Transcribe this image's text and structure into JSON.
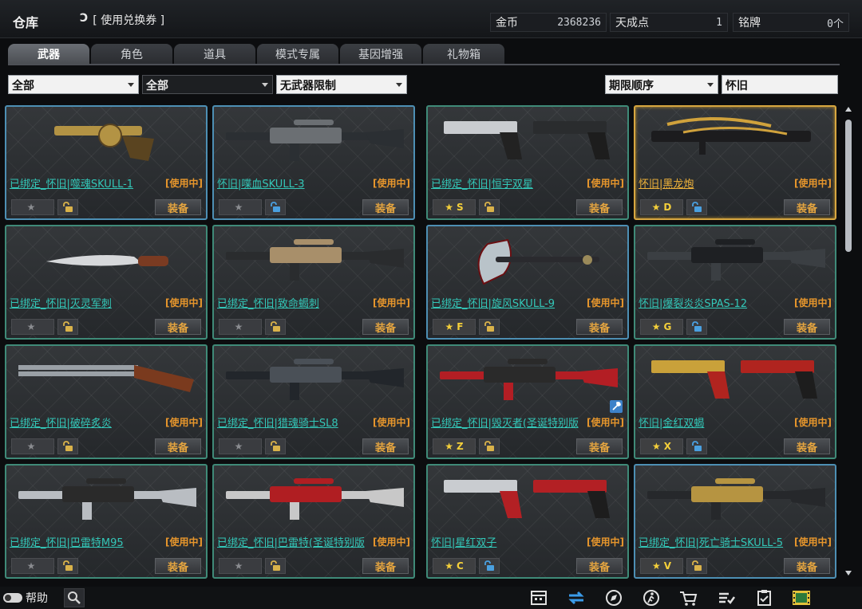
{
  "header": {
    "title": "仓库",
    "coupon_arrow": "Ↄ",
    "coupon_label": "[ 使用兑换券 ]",
    "stats": [
      {
        "label": "金币",
        "value": "2368236"
      },
      {
        "label": "天成点",
        "value": "1"
      },
      {
        "label": "铭牌",
        "value": "0个"
      }
    ]
  },
  "tabs": [
    "武器",
    "角色",
    "道具",
    "模式专属",
    "基因增强",
    "礼物箱"
  ],
  "filters": {
    "filter1": "全部",
    "filter2": "全部",
    "filter3": "无武器限制",
    "sort": "期限顺序",
    "search_value": "怀旧"
  },
  "items": [
    {
      "name": "已绑定_怀旧|噬魂SKULL-1",
      "status": "[使用中]",
      "grade_star": "★",
      "grade": "",
      "lock": "gold",
      "equip": "装备",
      "border": "blue",
      "art": "revolver"
    },
    {
      "name": "怀旧|喋血SKULL-3",
      "status": "[使用中]",
      "grade_star": "★",
      "grade": "",
      "lock": "blue",
      "equip": "装备",
      "border": "blue",
      "art": "smg"
    },
    {
      "name": "已绑定_怀旧|恒宇双星",
      "status": "[使用中]",
      "grade_star": "★",
      "grade": "S",
      "lock": "gold",
      "equip": "装备",
      "border": "green",
      "art": "dual"
    },
    {
      "name": "怀旧|黑龙炮",
      "status": "[使用中]",
      "grade_star": "★",
      "grade": "D",
      "lock": "blue",
      "equip": "装备",
      "border": "gold",
      "art": "shotgun-gold"
    },
    {
      "name": "已绑定_怀旧|灭灵军刺",
      "status": "[使用中]",
      "grade_star": "★",
      "grade": "",
      "lock": "gold",
      "equip": "装备",
      "border": "green",
      "art": "knife"
    },
    {
      "name": "已绑定_怀旧|致命蝎刺",
      "status": "[使用中]",
      "grade_star": "★",
      "grade": "",
      "lock": "gold",
      "equip": "装备",
      "border": "green",
      "art": "vector"
    },
    {
      "name": "已绑定_怀旧|旋风SKULL-9",
      "status": "[使用中]",
      "grade_star": "★",
      "grade": "F",
      "lock": "gold",
      "equip": "装备",
      "border": "blue",
      "art": "axe"
    },
    {
      "name": "怀旧|爆裂炎炎SPAS-12",
      "status": "[使用中]",
      "grade_star": "★",
      "grade": "G",
      "lock": "blue",
      "equip": "装备",
      "border": "green",
      "art": "spas"
    },
    {
      "name": "已绑定_怀旧|破碎炙炎",
      "status": "[使用中]",
      "grade_star": "★",
      "grade": "",
      "lock": "gold",
      "equip": "装备",
      "border": "green",
      "art": "double-barrel"
    },
    {
      "name": "已绑定_怀旧|猎魂骑士SL8",
      "status": "[使用中]",
      "grade_star": "★",
      "grade": "",
      "lock": "gold",
      "equip": "装备",
      "border": "green",
      "art": "sniper-dark"
    },
    {
      "name": "已绑定_怀旧|毁灭者(圣诞特别版)",
      "status": "[使用中]",
      "grade_star": "★",
      "grade": "Z",
      "lock": "gold",
      "equip": "装备",
      "border": "green",
      "art": "mg-red",
      "wrench": true
    },
    {
      "name": "怀旧|金红双蝎",
      "status": "[使用中]",
      "grade_star": "★",
      "grade": "X",
      "lock": "blue",
      "equip": "装备",
      "border": "green",
      "art": "dual-goldred"
    },
    {
      "name": "已绑定_怀旧|巴雷特M95",
      "status": "[使用中]",
      "grade_star": "★",
      "grade": "",
      "lock": "gold",
      "equip": "装备",
      "border": "green",
      "art": "m95"
    },
    {
      "name": "已绑定_怀旧|巴雷特(圣诞特别版)",
      "status": "[使用中]",
      "grade_star": "★",
      "grade": "",
      "lock": "gold",
      "equip": "装备",
      "border": "green",
      "art": "barrett-xmas"
    },
    {
      "name": "怀旧|星红双子",
      "status": "[使用中]",
      "grade_star": "★",
      "grade": "C",
      "lock": "blue",
      "equip": "装备",
      "border": "green",
      "art": "dual-red"
    },
    {
      "name": "已绑定_怀旧|死亡骑士SKULL-5",
      "status": "[使用中]",
      "grade_star": "★",
      "grade": "V",
      "lock": "gold",
      "equip": "装备",
      "border": "blue",
      "art": "rifle-gold"
    }
  ],
  "footer": {
    "help": "帮助",
    "icons": [
      "calendar-icon",
      "refresh-icon",
      "compass-icon",
      "running-icon",
      "cart-icon",
      "checklist-icon",
      "clipboard-icon",
      "film-icon"
    ]
  },
  "colors": {
    "name_teal": "#33c7b8",
    "name_gold": "#f0b33a",
    "in_use_orange": "#e7962c",
    "border_green": "#3f8a78",
    "border_blue": "#4d8fb4",
    "border_gold": "#d7a640",
    "star_yellow": "#f4cf3a"
  }
}
